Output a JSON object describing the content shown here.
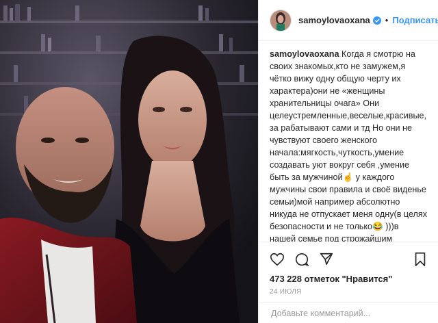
{
  "header": {
    "username": "samoylovaoxana",
    "follow_label": "Подписаться",
    "separator": "•"
  },
  "caption": {
    "username": "samoylovaoxana",
    "text": "Когда я смотрю на своих знакомых,кто не замужем,я чётко вижу одну общую черту их характера)они не «женщины хранительницы очага» Они целеустремленные,веселые,красивые,за рабатывают сами и тд Но они не чувствуют своего женского начала:мягкость,чуткость,умение создавать уют вокруг себя ,умение быть за мужчиной☝️ у каждого мужчины свои правила и своё виденье семьи)мой например абсолютно никуда не отпускает меня одну(в целях безопасности и не только😂 )))в нашей семье под строжайшим запретом жена гуляющая(сидящая в ресторане и тд) сама по себе/с подругами )вариант отдельного отпуска -это вообще за гранью нашей реальности)))😅 когда мне муж 10 лет назад впервые сообщил эту"
  },
  "likes": "473 228 отметок \"Нравится\"",
  "date": "24 ИЮЛЯ",
  "comment_placeholder": "Добавьте комментарий...",
  "icons": [
    "heart-icon",
    "comment-icon",
    "share-icon",
    "bookmark-icon",
    "verified-badge-icon"
  ],
  "colors": {
    "accent": "#3897f0",
    "text": "#262626",
    "muted": "#999999",
    "border": "#efefef"
  }
}
